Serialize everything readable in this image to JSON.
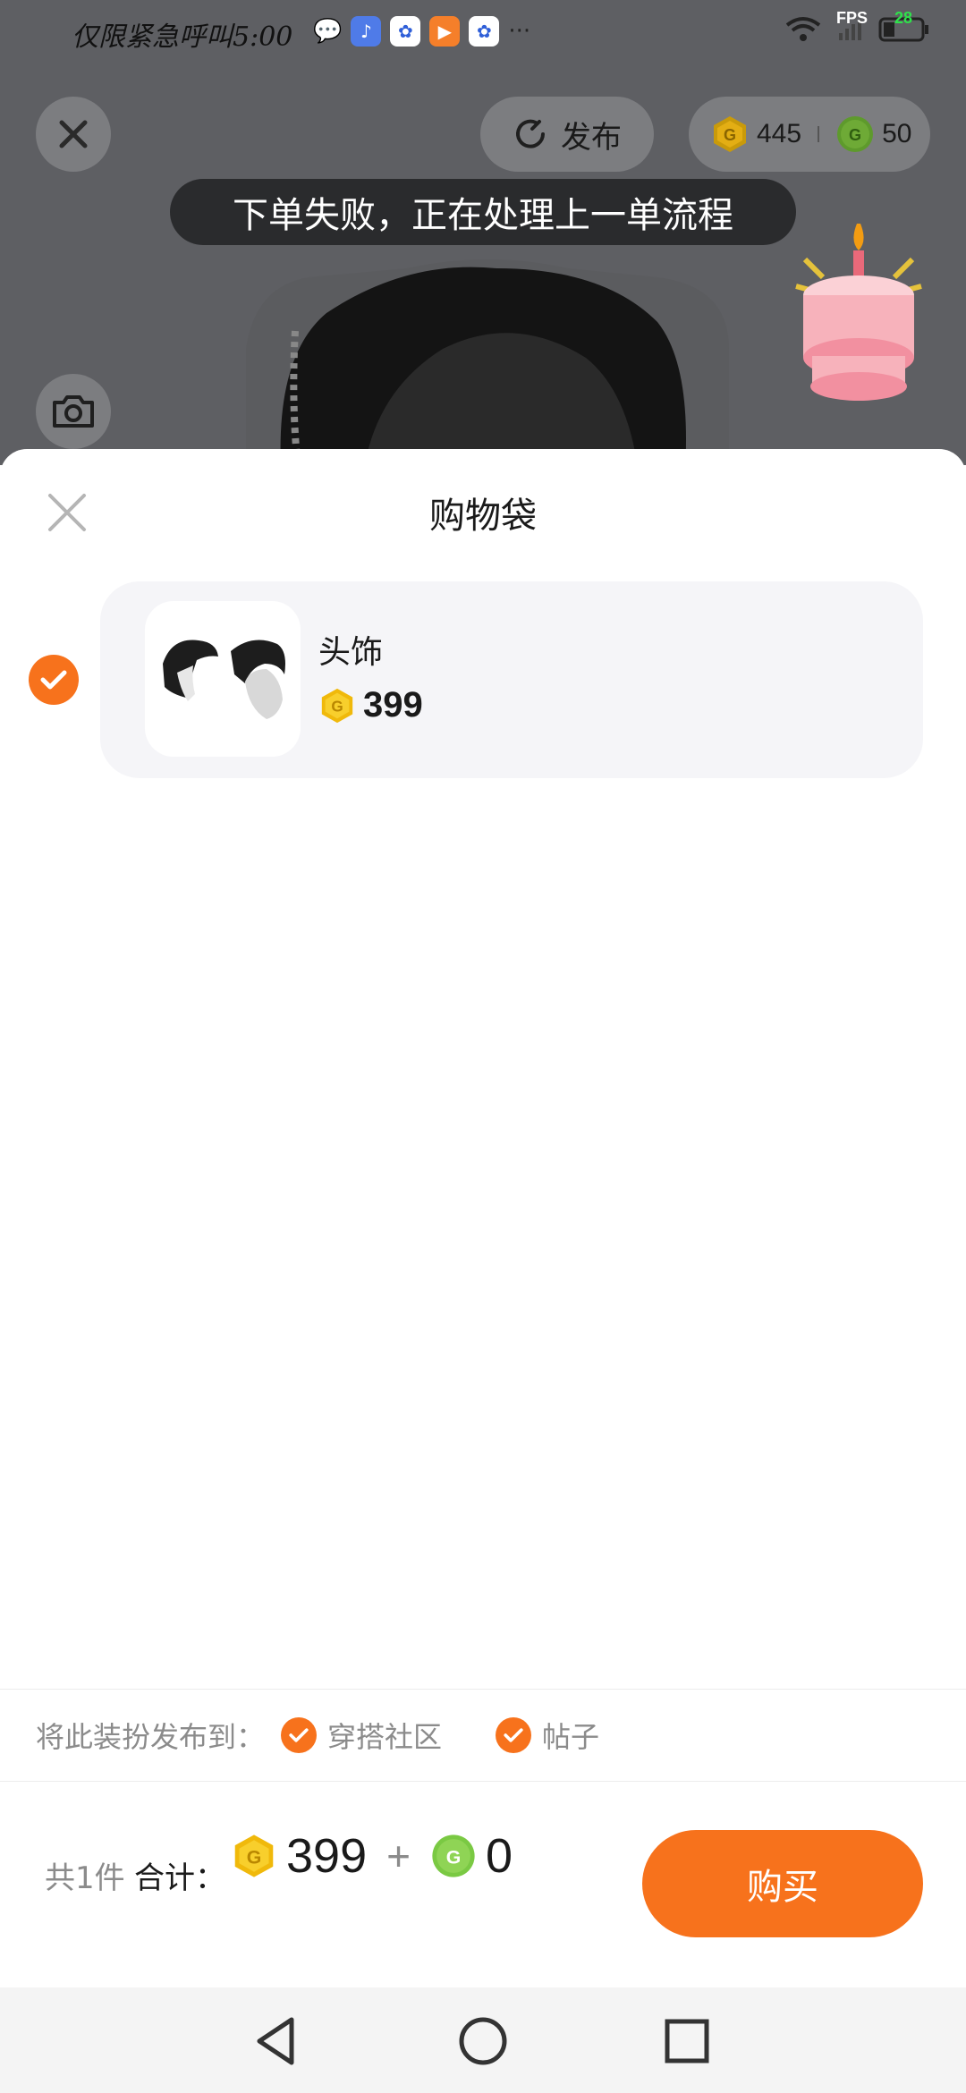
{
  "status_bar": {
    "carrier_text": "仅限紧急呼叫",
    "time": "5:00",
    "more": "···",
    "fps_label": "FPS",
    "fps_value": "28"
  },
  "top_bar": {
    "publish_label": "发布",
    "gold_coins": "445",
    "green_coins": "50"
  },
  "toast": {
    "message": "下单失败，正在处理上一单流程"
  },
  "sheet": {
    "title": "购物袋",
    "items": [
      {
        "name": "头饰",
        "price": "399",
        "checked": true
      }
    ]
  },
  "publish_to": {
    "label": "将此装扮发布到：",
    "options": [
      {
        "label": "穿搭社区",
        "checked": true
      },
      {
        "label": "帖子",
        "checked": true
      }
    ]
  },
  "footer": {
    "count": "共1件",
    "total_label": "合计：",
    "gold_total": "399",
    "plus": "+",
    "green_total": "0",
    "buy_label": "购买"
  },
  "colors": {
    "accent": "#f7721c",
    "gold": "#f5c518",
    "green": "#7ac943"
  },
  "icons": {
    "close": "close-icon",
    "camera": "camera-icon",
    "publish": "refresh-icon",
    "gold_coin": "gold-coin-icon",
    "green_coin": "green-coin-icon",
    "check": "check-icon",
    "nav_back": "triangle-back-icon",
    "nav_home": "circle-home-icon",
    "nav_recent": "square-recent-icon"
  }
}
